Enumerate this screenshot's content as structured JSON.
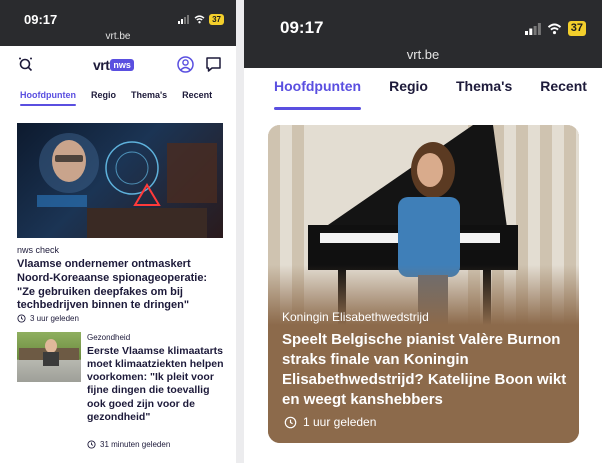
{
  "left_phone": {
    "status": {
      "time": "09:17",
      "battery": "37",
      "url": "vrt.be"
    },
    "logo": {
      "vrt": "vrt",
      "nws": "nws"
    },
    "tabs": [
      "Hoofdpunten",
      "Regio",
      "Thema's",
      "Recent"
    ],
    "story1": {
      "kicker": "nws check",
      "headline": "Vlaamse ondernemer ontmaskert Noord-Koreaanse spionageoperatie: \"Ze gebruiken deepfakes om bij techbedrijven binnen te dringen\"",
      "time": "3 uur geleden"
    },
    "story2": {
      "kicker": "Gezondheid",
      "headline": "Eerste Vlaamse klimaatarts moet klimaatziekten helpen voorkomen: \"Ik pleit voor fijne dingen die toevallig ook goed zijn voor de gezondheid\"",
      "time": "31 minuten geleden"
    }
  },
  "right_phone": {
    "status": {
      "time": "09:17",
      "battery": "37",
      "url": "vrt.be"
    },
    "tabs": [
      "Hoofdpunten",
      "Regio",
      "Thema's",
      "Recent"
    ],
    "card": {
      "kicker": "Koningin Elisabethwedstrijd",
      "headline": "Speelt Belgische pianist Valère Burnon straks finale van Koningin Elisabethwedstrijd? Katelijne Boon wikt en weegt kanshebbers",
      "time": "1 uur geleden"
    }
  },
  "colors": {
    "accent": "#5a4fe0",
    "card_bg": "#8c6a4b",
    "status_bar": "#2a2b2e",
    "battery": "#f3cf2c"
  }
}
